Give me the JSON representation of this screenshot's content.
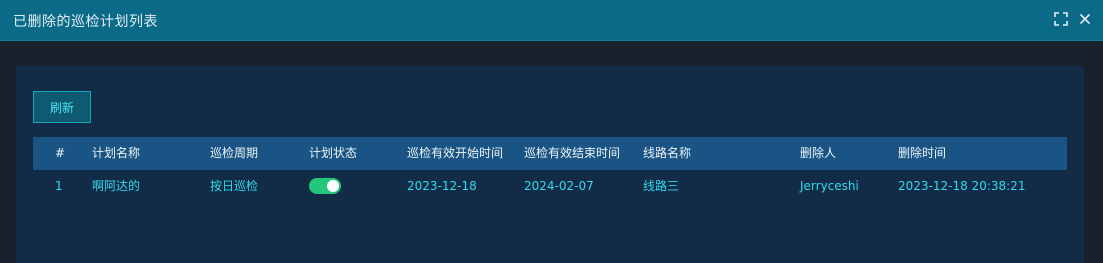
{
  "dialog": {
    "title": "已删除的巡检计划列表",
    "maximize_icon": "maximize-icon",
    "close_icon": "close-icon"
  },
  "toolbar": {
    "refresh_label": "刷新"
  },
  "table": {
    "columns": [
      "#",
      "计划名称",
      "巡检周期",
      "计划状态",
      "巡检有效开始时间",
      "巡检有效结束时间",
      "线路名称",
      "删除人",
      "删除时间"
    ],
    "rows": [
      {
        "index": "1",
        "plan_name": "啊阿达的",
        "cycle": "按日巡检",
        "status_enabled": true,
        "start_date": "2023-12-18",
        "end_date": "2024-02-07",
        "route_name": "线路三",
        "deleted_by": "Jerryceshi",
        "deleted_at": "2023-12-18 20:38:21"
      }
    ]
  },
  "colors": {
    "header_bg": "#0b6a88",
    "panel_bg": "#122c48",
    "table_header_bg": "#1a5484",
    "cell_text": "#32d8ee",
    "toggle_on": "#23c77a"
  }
}
